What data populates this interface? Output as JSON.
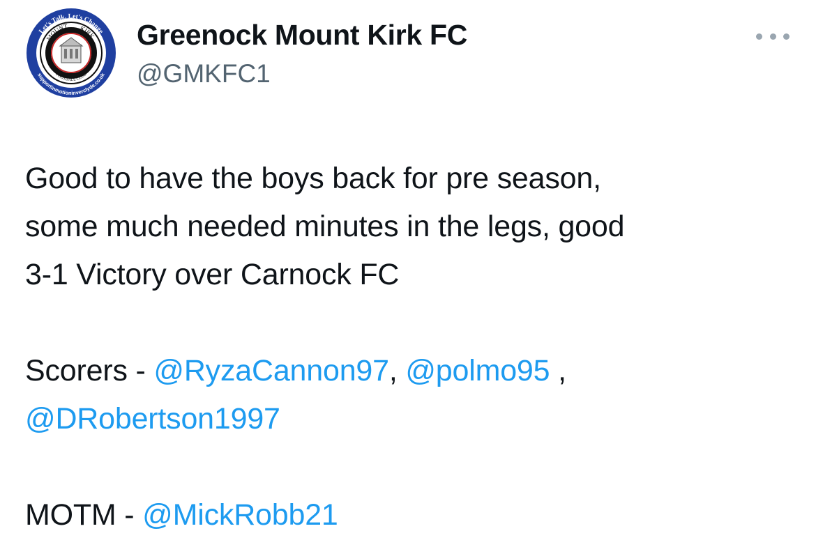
{
  "author": {
    "display_name": "Greenock Mount Kirk FC",
    "handle": "@GMKFC1",
    "avatar_logo": {
      "ring_top_text": "Let's Talk, Let's Change",
      "name_top": "MOUNT",
      "name_top2": "KIRK",
      "name_bottom": "FOOTBALL CLUB",
      "ring_bottom_text": "supportinmotioninverclyde.co.uk",
      "colors": {
        "outer_ring": "#1f3fa0",
        "inner_ring": "#111111",
        "accent": "#c62828"
      }
    }
  },
  "menu": {
    "icon": "more-horizontal-icon"
  },
  "tweet": {
    "line1": "Good to have the boys back for pre season,",
    "line2": "some much needed minutes in the legs, good",
    "line3": "3-1 Victory over Carnock FC",
    "scorers_prefix": "Scorers - ",
    "scorer1": "@RyzaCannon97",
    "sep1": ", ",
    "scorer2": "@polmo95",
    "sep2": " ,",
    "scorer3": "@DRobertson1997",
    "motm_prefix": "MOTM - ",
    "motm": "@MickRobb21"
  },
  "colors": {
    "text": "#0f1419",
    "secondary": "#536471",
    "link": "#1d9bf0"
  }
}
